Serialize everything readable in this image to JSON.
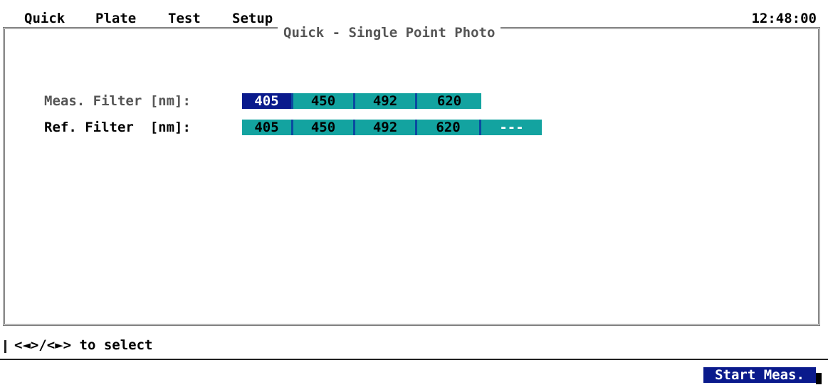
{
  "menu": {
    "items": [
      "Quick",
      "Plate",
      "Test",
      "Setup"
    ],
    "clock": "12:48:00"
  },
  "panel": {
    "title": "Quick - Single Point Photo"
  },
  "meas_filter": {
    "label": "Meas. Filter [nm]:",
    "options": [
      "405",
      "450",
      "492",
      "620"
    ],
    "selected": "405"
  },
  "ref_filter": {
    "label": "Ref. Filter  [nm]:",
    "options": [
      "405",
      "450",
      "492",
      "620",
      "---"
    ],
    "selected": null
  },
  "status": {
    "hint": "<◄>/<►> to select"
  },
  "actions": {
    "start_label": "Start Meas."
  },
  "colors": {
    "option_bg": "#13a3a0",
    "selected_bg": "#0a1a8c",
    "separator": "#0a4aa0"
  }
}
